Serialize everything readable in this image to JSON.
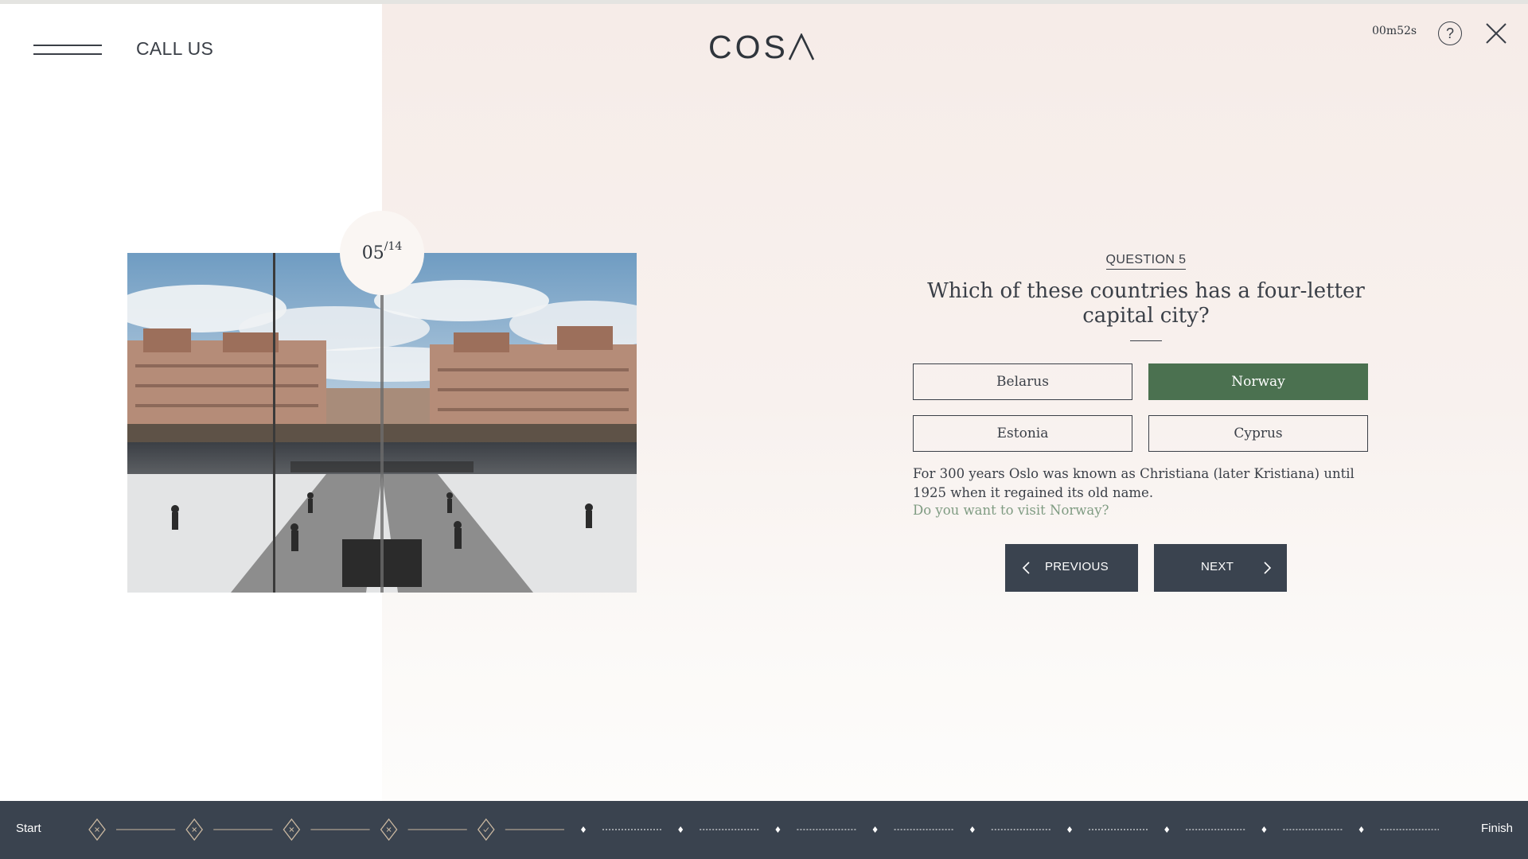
{
  "header": {
    "call_label": "CALL US",
    "logo_text": "COS",
    "timer": "00m52s",
    "help_symbol": "?"
  },
  "card": {
    "current": "05",
    "total": "/14"
  },
  "question": {
    "label": "QUESTION 5",
    "text": "Which of these countries has a four-letter capital city?",
    "answers": [
      {
        "label": "Belarus",
        "selected": false
      },
      {
        "label": "Norway",
        "selected": true
      },
      {
        "label": "Estonia",
        "selected": false
      },
      {
        "label": "Cyprus",
        "selected": false
      }
    ],
    "explanation": "For 300 years Oslo was known as Christiana (later Kristiana) until 1925 when it regained its old name.",
    "visit_link": "Do you want to visit Norway?"
  },
  "nav": {
    "previous_label": "PREVIOUS",
    "next_label": "NEXT"
  },
  "progress": {
    "start_label": "Start",
    "finish_label": "Finish",
    "total_steps": 14,
    "answered": [
      "wrong",
      "wrong",
      "wrong",
      "wrong",
      "correct"
    ]
  },
  "icons": {
    "menu": "hamburger-icon",
    "help": "question-circle-icon",
    "close": "close-icon",
    "prev": "chevron-left-icon",
    "next": "chevron-right-icon"
  },
  "colors": {
    "selected_answer": "#4b7150",
    "dark_bar": "#3a434f",
    "link": "#7f9b82"
  }
}
